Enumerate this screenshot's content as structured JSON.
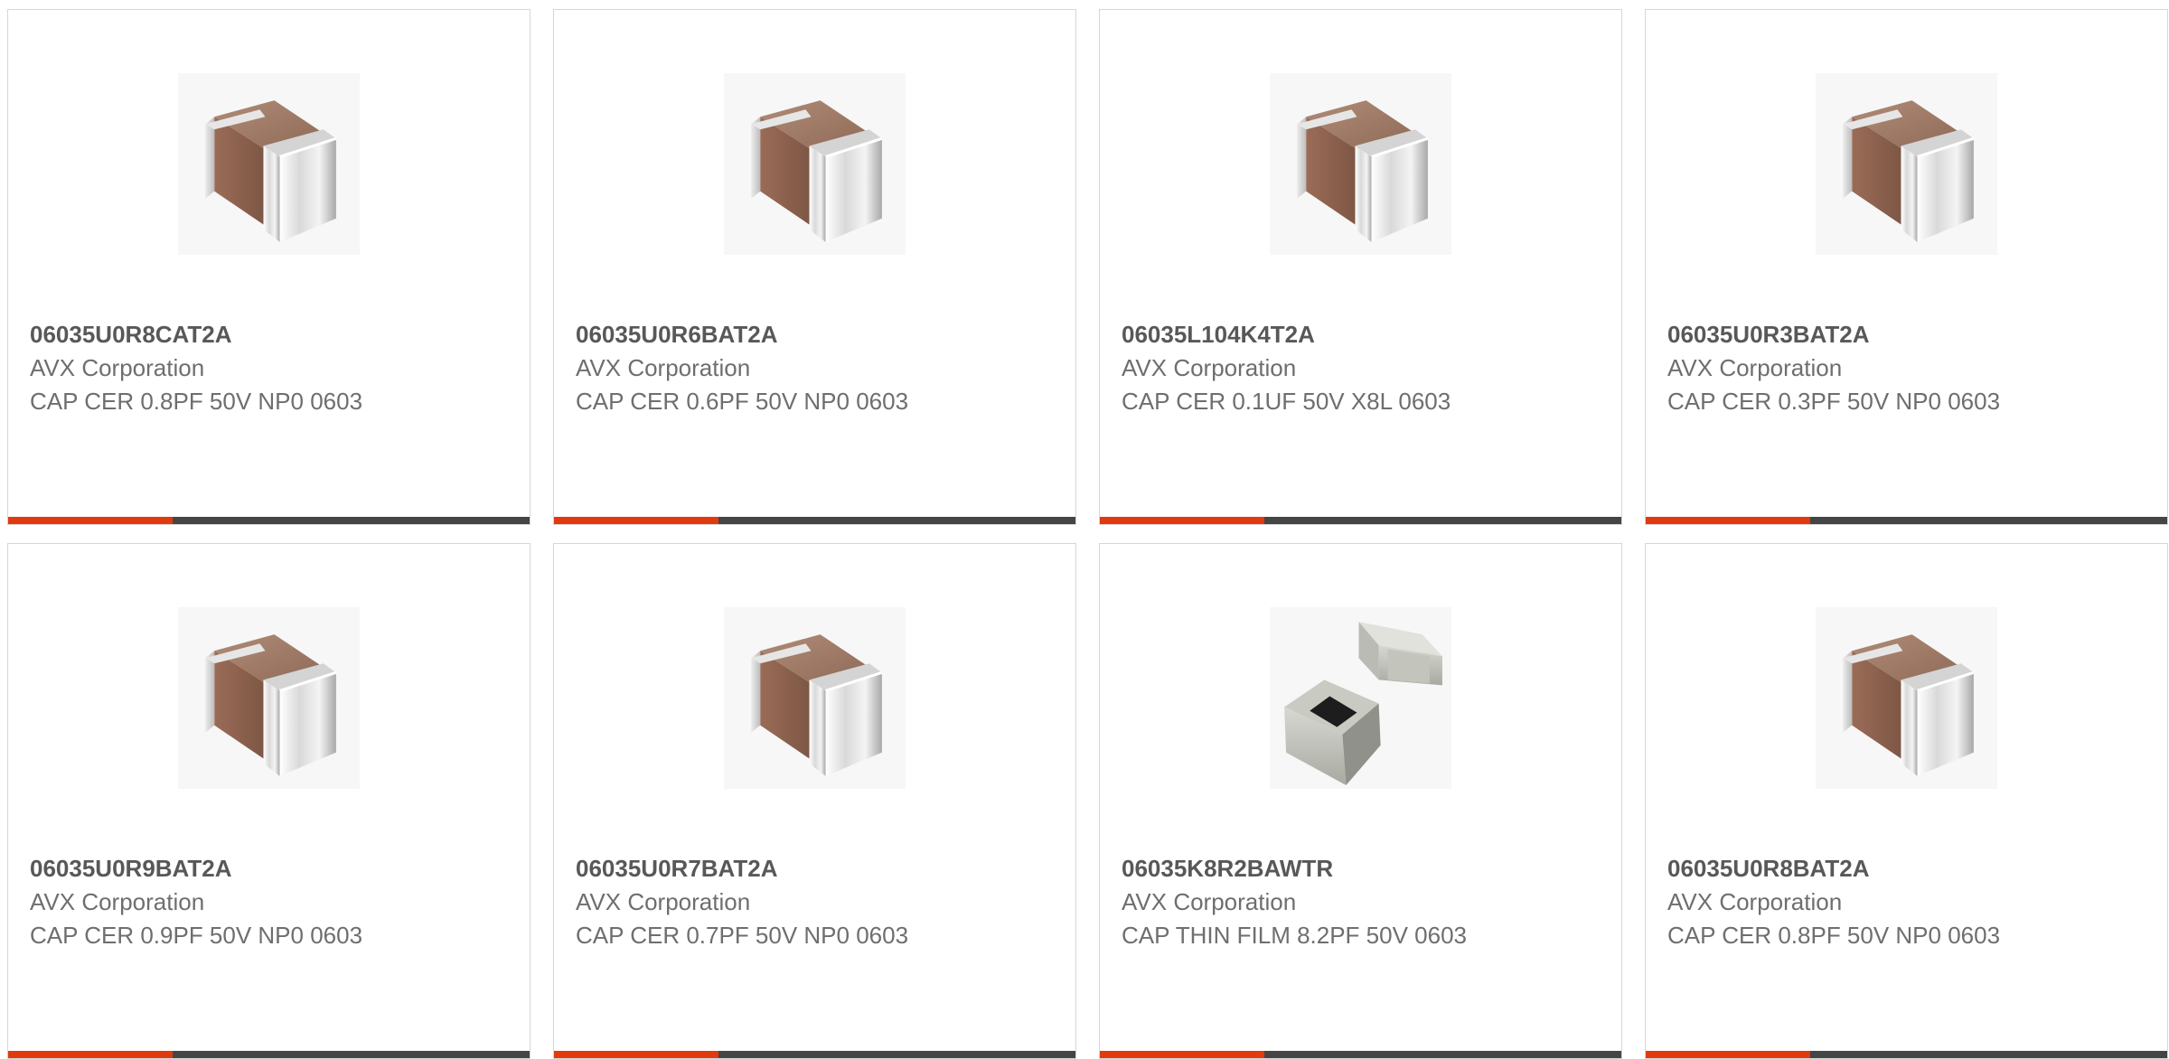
{
  "colors": {
    "accent": "#e03a0e",
    "bar": "#454545",
    "border": "#d6d6d6",
    "part_number_text": "#585858",
    "secondary_text": "#6e6e6e"
  },
  "products": [
    {
      "part_number": "06035U0R8CAT2A",
      "manufacturer": "AVX Corporation",
      "description": "CAP CER 0.8PF 50V NP0 0603",
      "image": "mlcc-capacitor-icon"
    },
    {
      "part_number": "06035U0R6BAT2A",
      "manufacturer": "AVX Corporation",
      "description": "CAP CER 0.6PF 50V NP0 0603",
      "image": "mlcc-capacitor-icon"
    },
    {
      "part_number": "06035L104K4T2A",
      "manufacturer": "AVX Corporation",
      "description": "CAP CER 0.1UF 50V X8L 0603",
      "image": "mlcc-capacitor-icon"
    },
    {
      "part_number": "06035U0R3BAT2A",
      "manufacturer": "AVX Corporation",
      "description": "CAP CER 0.3PF 50V NP0 0603",
      "image": "mlcc-capacitor-icon"
    },
    {
      "part_number": "06035U0R9BAT2A",
      "manufacturer": "AVX Corporation",
      "description": "CAP CER 0.9PF 50V NP0 0603",
      "image": "mlcc-capacitor-icon"
    },
    {
      "part_number": "06035U0R7BAT2A",
      "manufacturer": "AVX Corporation",
      "description": "CAP CER 0.7PF 50V NP0 0603",
      "image": "mlcc-capacitor-icon"
    },
    {
      "part_number": "06035K8R2BAWTR",
      "manufacturer": "AVX Corporation",
      "description": "CAP THIN FILM 8.2PF 50V 0603",
      "image": "thin-film-chip-icon"
    },
    {
      "part_number": "06035U0R8BAT2A",
      "manufacturer": "AVX Corporation",
      "description": "CAP CER 0.8PF 50V NP0 0603",
      "image": "mlcc-capacitor-icon"
    }
  ]
}
